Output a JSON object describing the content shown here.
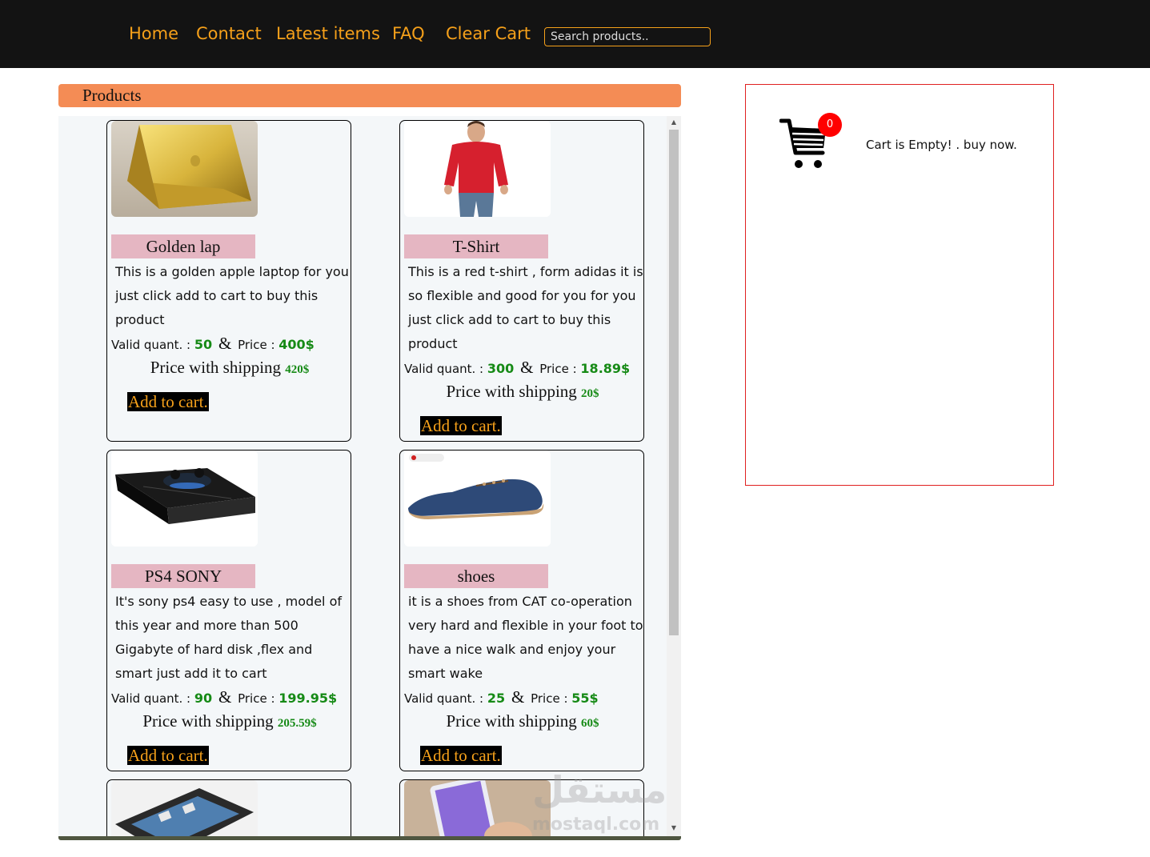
{
  "nav": {
    "home": "Home",
    "contact": "Contact",
    "latest": "Latest items",
    "faq": "FAQ",
    "clear_cart": "Clear Cart",
    "search_placeholder": "Search products.."
  },
  "products_header": "Products",
  "labels": {
    "valid_quant": "Valid quant. :",
    "amp": "&",
    "price": "Price :",
    "price_with_shipping": "Price with shipping",
    "add_to_cart": "Add to cart."
  },
  "products": [
    {
      "title": "Golden lap",
      "description": "This is a golden apple laptop for you just click add to cart to buy this product",
      "quantity": "50",
      "price": "400$",
      "shipping_price": "420$",
      "image": "golden-laptop"
    },
    {
      "title": "T-Shirt",
      "description": "This is a red t-shirt , form adidas it is so flexible and good for you for you just click add to cart to buy this product",
      "quantity": "300",
      "price": "18.89$",
      "shipping_price": "20$",
      "image": "red-tshirt"
    },
    {
      "title": "PS4 SONY",
      "description": "It's sony ps4 easy to use , model of this year and more than 500 Gigabyte of hard disk ,flex and smart just add it to cart",
      "quantity": "90",
      "price": "199.95$",
      "shipping_price": "205.59$",
      "image": "ps4-console"
    },
    {
      "title": "shoes",
      "description": "it is a shoes from CAT co-operation very hard and flexible in your foot to have a nice walk and enjoy your smart wake",
      "quantity": "25",
      "price": "55$",
      "shipping_price": "60$",
      "image": "blue-shoe"
    }
  ],
  "cart": {
    "count": "0",
    "message": "Cart is Empty! . buy now.",
    "icon": "shopping-cart-icon"
  },
  "watermark": {
    "arabic": "مستقل",
    "latin": "mostaql.com"
  },
  "colors": {
    "nav_bg": "#131313",
    "nav_link": "#f5a01a",
    "products_header": "#f48c55",
    "title_bg": "#e5b6c2",
    "value_green": "#168a16",
    "badge": "#ff0000",
    "cart_border": "#e02020"
  }
}
